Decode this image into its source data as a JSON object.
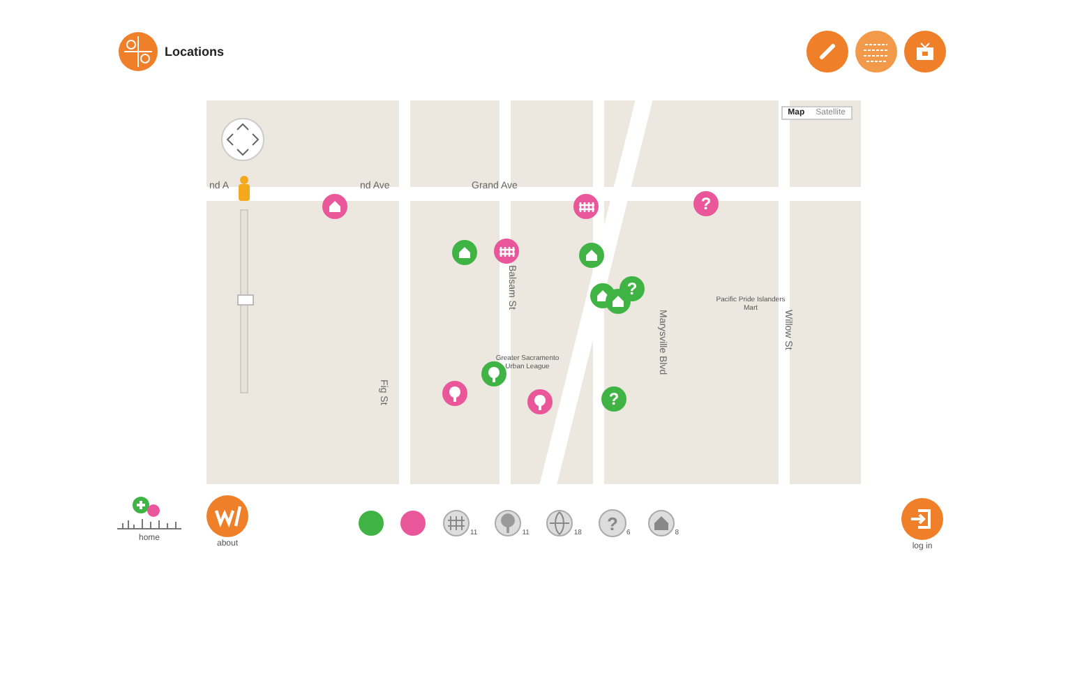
{
  "header": {
    "title": "Locations"
  },
  "map": {
    "street_labels": [
      {
        "text": "nd A",
        "kind": "h"
      },
      {
        "text": "nd Ave",
        "kind": "h"
      },
      {
        "text": "Grand Ave",
        "kind": "h"
      },
      {
        "text": "Balsam St",
        "kind": "v"
      },
      {
        "text": "Marysville Blvd",
        "kind": "v"
      },
      {
        "text": "Willow St",
        "kind": "v"
      },
      {
        "text": "Fig St",
        "kind": "v"
      }
    ],
    "places": [
      "Greater Sacramento Urban League",
      "Pacific Pride Islanders Mart"
    ],
    "map_types": [
      {
        "label": "Map",
        "selected": true
      },
      {
        "label": "Satellite",
        "selected": false
      }
    ],
    "markers": [
      {
        "kind": "house",
        "color": "#e9569a"
      },
      {
        "kind": "fence",
        "color": "#e9569a"
      },
      {
        "kind": "question",
        "color": "#e9569a",
        "symbol": "?"
      },
      {
        "kind": "house",
        "color": "#3fb343"
      },
      {
        "kind": "fence",
        "color": "#e9569a"
      },
      {
        "kind": "house",
        "color": "#3fb343"
      },
      {
        "kind": "house",
        "color": "#3fb343"
      },
      {
        "kind": "house",
        "color": "#3fb343"
      },
      {
        "kind": "question",
        "color": "#3fb343",
        "symbol": "?"
      },
      {
        "kind": "tree",
        "color": "#3fb343"
      },
      {
        "kind": "tree",
        "color": "#e9569a"
      },
      {
        "kind": "tree",
        "color": "#e9569a"
      },
      {
        "kind": "question",
        "color": "#3fb343",
        "symbol": "?"
      }
    ],
    "zoom": {
      "level": 0.5
    }
  },
  "nav": [
    {
      "label": "home"
    },
    {
      "label": "about"
    }
  ],
  "filters": {
    "colors": [
      {
        "color": "#3fb343"
      },
      {
        "color": "#e9569a"
      }
    ],
    "categories": [
      {
        "kind": "fence",
        "count": "11"
      },
      {
        "kind": "tree",
        "count": "11"
      },
      {
        "kind": "globe",
        "count": "18"
      },
      {
        "kind": "question",
        "symbol": "?",
        "count": "6"
      },
      {
        "kind": "house",
        "count": "8"
      }
    ]
  },
  "login": {
    "label": "log in"
  }
}
